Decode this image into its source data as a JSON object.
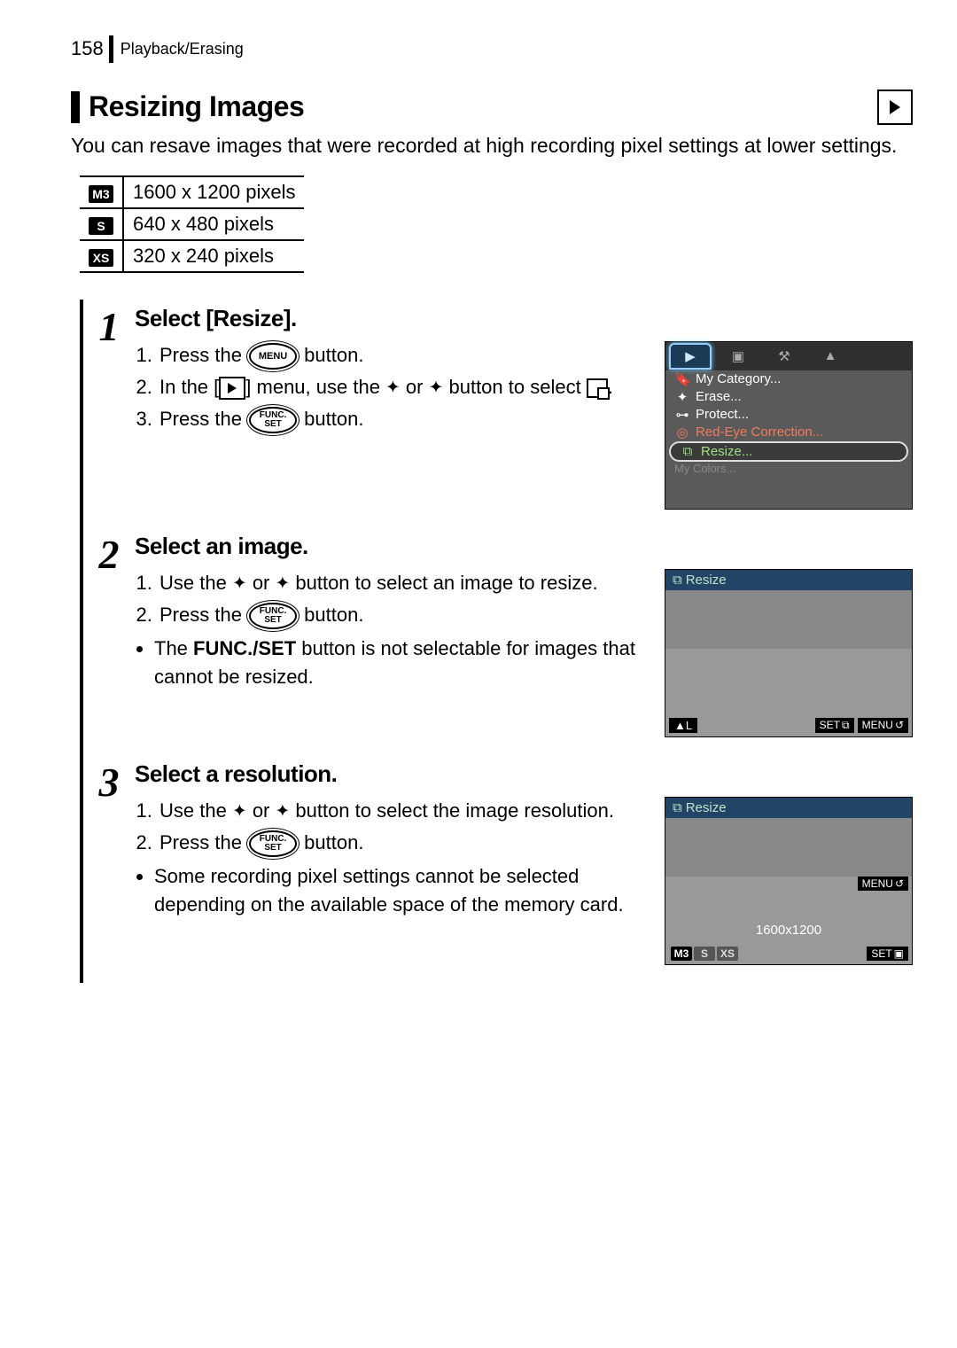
{
  "header": {
    "page_number": "158",
    "breadcrumb": "Playback/Erasing"
  },
  "title": "Resizing Images",
  "intro": "You can resave images that were recorded at high recording pixel settings at lower settings.",
  "size_table": [
    {
      "badge": "M3",
      "label": "1600 x 1200 pixels"
    },
    {
      "badge": "S",
      "label": "640 x 480 pixels"
    },
    {
      "badge": "XS",
      "label": "320 x 240 pixels"
    }
  ],
  "steps": [
    {
      "num": "1",
      "heading": "Select [Resize].",
      "lines": {
        "l1a": "Press the ",
        "l1b": " button.",
        "l2a": "In the [",
        "l2b": "] menu, use the ",
        "l2c": " or ",
        "l2d": " button to select ",
        "l2e": ".",
        "l3a": "Press the ",
        "l3b": " button."
      },
      "button_menu": "MENU",
      "button_func_top": "FUNC.",
      "button_func_bot": "SET",
      "lcd": {
        "menu": [
          {
            "icon": "🔖",
            "text": "My Category..."
          },
          {
            "icon": "✦",
            "text": "Erase..."
          },
          {
            "icon": "⊶",
            "text": "Protect..."
          },
          {
            "icon": "◎",
            "text": "Red-Eye Correction...",
            "red": true
          },
          {
            "icon": "⧉",
            "text": "Resize...",
            "hl": true
          },
          {
            "cut": true,
            "text": "My Colors..."
          }
        ]
      }
    },
    {
      "num": "2",
      "heading": "Select an image.",
      "lines": {
        "l1a": "Use the ",
        "l1b": " or ",
        "l1c": " button to select an image to resize.",
        "l2a": "Press the ",
        "l2b": " button."
      },
      "note_a": "The ",
      "note_bold": "FUNC./SET",
      "note_b": " button is not selectable for images that cannot be resized.",
      "button_func_top": "FUNC.",
      "button_func_bot": "SET",
      "lcd": {
        "hdr_text": "Resize",
        "bl": "▲L",
        "set": "SET",
        "menu": "MENU"
      }
    },
    {
      "num": "3",
      "heading": "Select a resolution.",
      "lines": {
        "l1a": "Use the ",
        "l1b": " or ",
        "l1c": " button to select the image resolution.",
        "l2a": "Press the ",
        "l2b": " button."
      },
      "note": "Some recording pixel settings cannot be selected depending on the available space of the memory card.",
      "button_func_top": "FUNC.",
      "button_func_bot": "SET",
      "lcd": {
        "hdr_text": "Resize",
        "res_value": "1600x1200",
        "chips": [
          "M3",
          "S",
          "XS"
        ],
        "menu": "MENU",
        "set": "SET"
      }
    }
  ]
}
